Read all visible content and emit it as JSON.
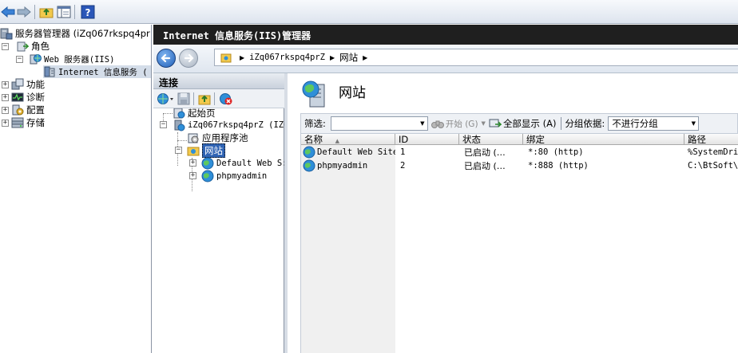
{
  "toolbar": {
    "icons": [
      "back-arrow-icon",
      "forward-arrow-icon",
      "up-folder-icon",
      "show-hide-tree-icon",
      "help-icon"
    ],
    "help_glyph": "?"
  },
  "left_tree": {
    "root": "服务器管理器 (iZq067rkspq4pr",
    "roles": "角色",
    "web_server": "Web 服务器(IIS)",
    "iis_item": "Internet 信息服务 (",
    "features": "功能",
    "diagnostics": "诊断",
    "configuration": "配置",
    "storage": "存储"
  },
  "iis": {
    "title": "Internet 信息服务(IIS)管理器",
    "breadcrumb": [
      "iZq067rkspq4prZ",
      "网站"
    ]
  },
  "connections": {
    "header": "连接",
    "tree": {
      "start_page": "起始页",
      "server": "iZq067rkspq4prZ (IZQ",
      "app_pools": "应用程序池",
      "sites": "网站",
      "default_site": "Default Web S:",
      "phpmyadmin": "phpmyadmin"
    }
  },
  "main": {
    "title": "网站",
    "filter": {
      "label": "筛选:",
      "value": "",
      "start_label": "开始 (G)",
      "show_all_label": "全部显示 (A)",
      "group_by_label": "分组依据:",
      "group_by_value": "不进行分组"
    },
    "columns": [
      "名称",
      "ID",
      "状态",
      "绑定",
      "路径"
    ],
    "rows": [
      {
        "name": "Default Web Site",
        "id": "1",
        "status": "已启动 (…",
        "binding": "*:80 (http)",
        "path": "%SystemDriv"
      },
      {
        "name": "phpmyadmin",
        "id": "2",
        "status": "已启动 (…",
        "binding": "*:888 (http)",
        "path": "C:\\BtSoft\\p"
      }
    ]
  },
  "colors": {
    "title_bar": "#1f1f1f",
    "selection": "#3064b4",
    "globe": "#2f8fd8"
  }
}
